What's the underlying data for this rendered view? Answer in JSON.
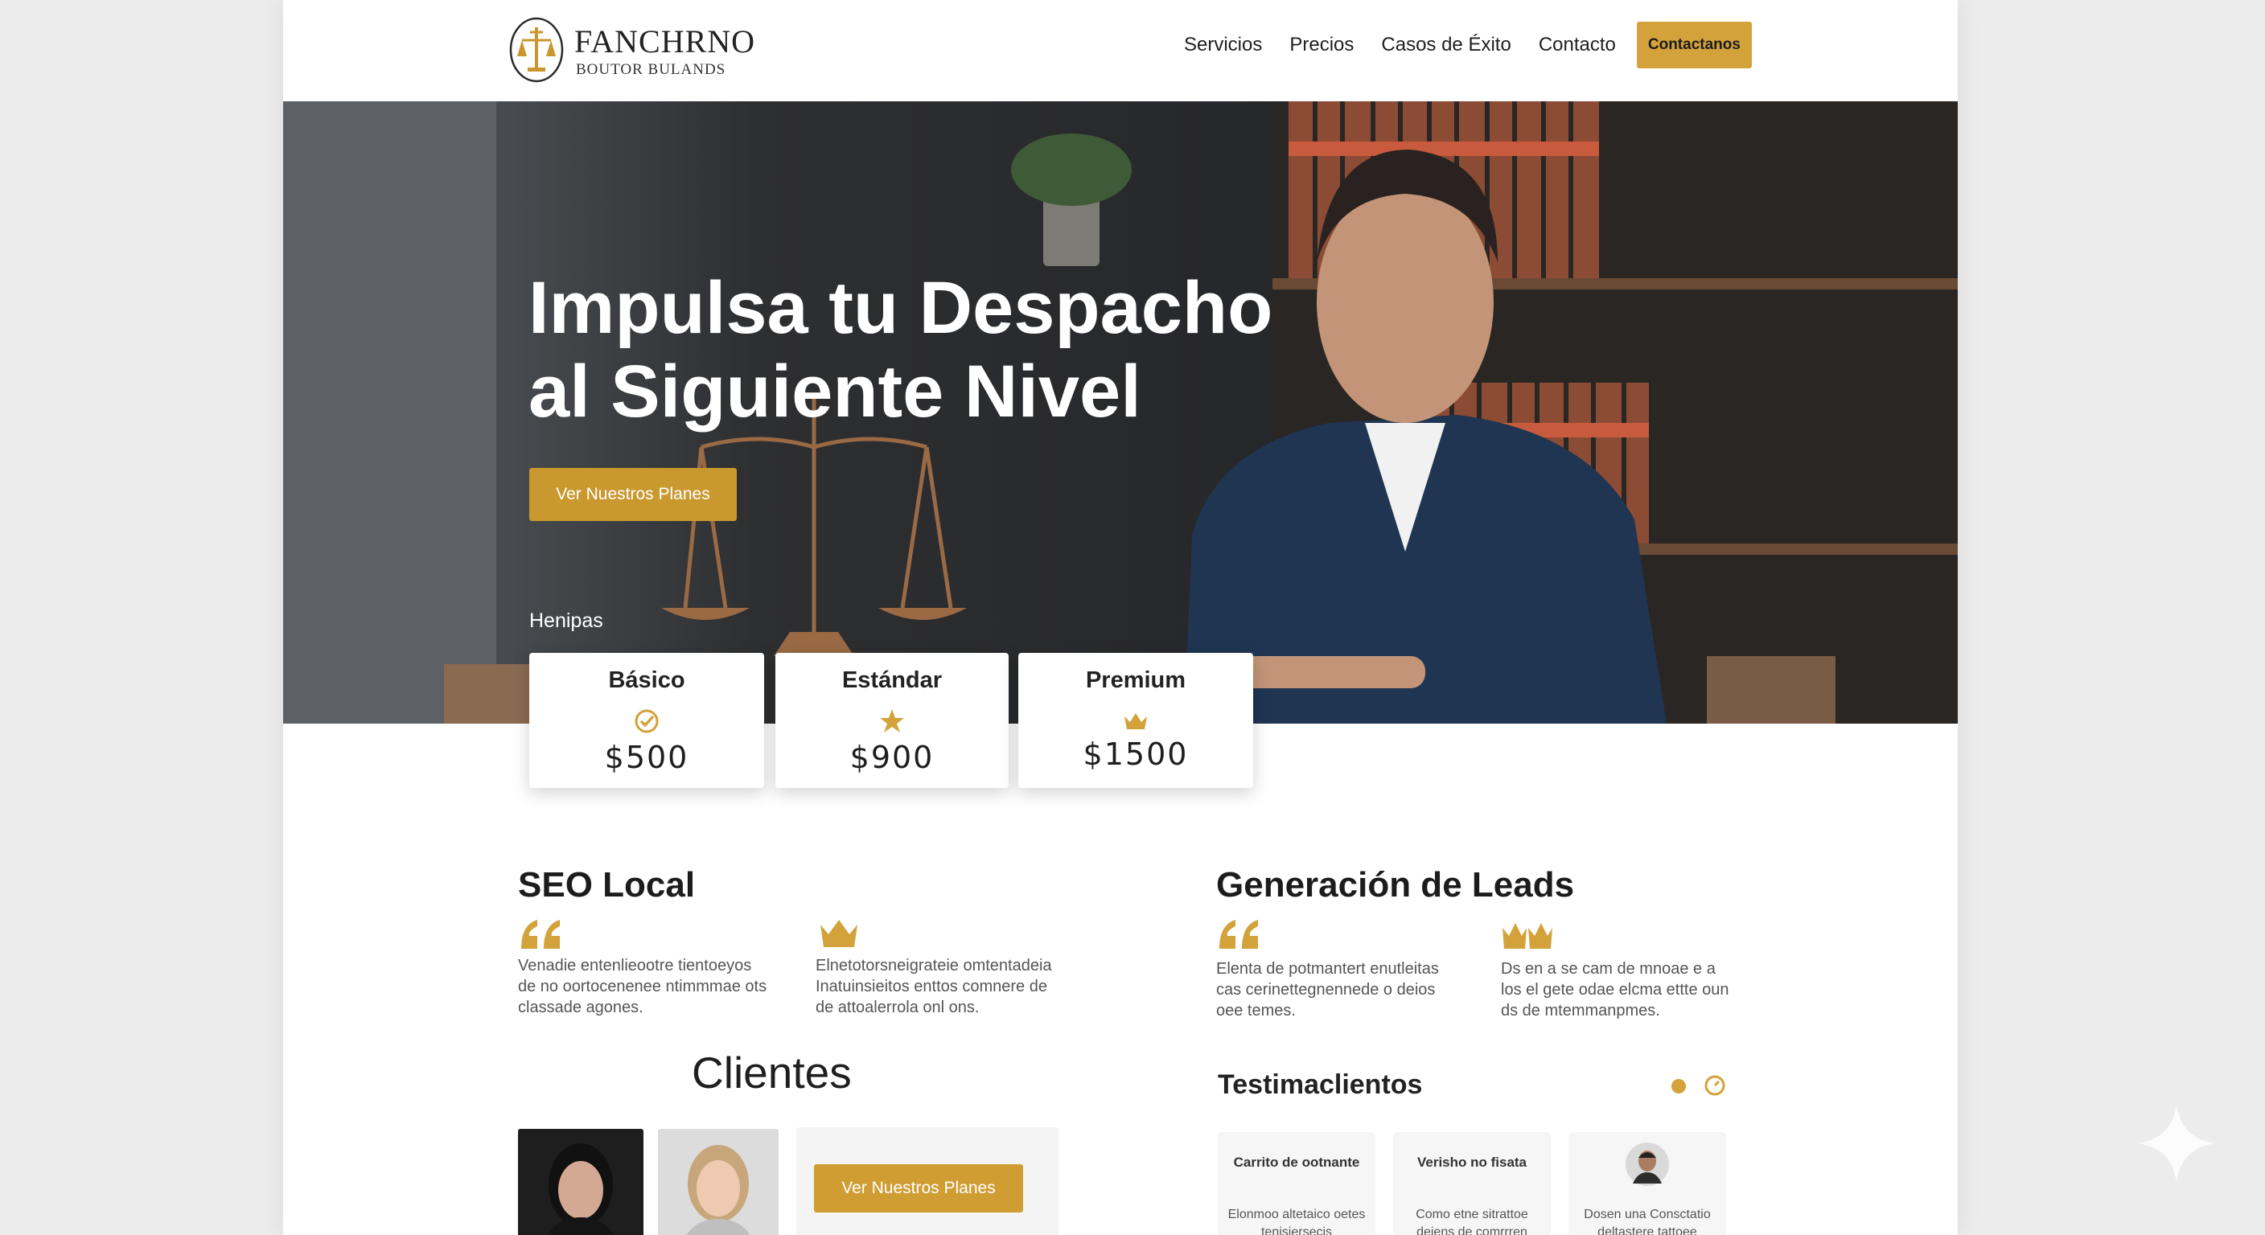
{
  "brand": {
    "name": "FANCHRNO",
    "tagline": "BOUTOR BULANDS",
    "accent": "#d4a23a"
  },
  "nav": {
    "items": [
      "Servicios",
      "Precios",
      "Casos de Éxito",
      "Contacto"
    ],
    "cta": "Contactanos"
  },
  "hero": {
    "title_line1": "Impulsa tu Despacho",
    "title_line2": "al Siguiente Nivel",
    "button": "Ver Nuestros Planes",
    "subheading": "Henipas"
  },
  "plans": [
    {
      "name": "Básico",
      "icon": "check-circle-icon",
      "price": "$500"
    },
    {
      "name": "Estándar",
      "icon": "star-icon",
      "price": "$900"
    },
    {
      "name": "Premium",
      "icon": "crown-icon",
      "price": "$1500"
    }
  ],
  "seo": {
    "title": "SEO Local",
    "col1": "Venadie entenlieootre tientoeyos de no oortocenenee ntimmmae ots classade agones.",
    "col2": "Elnetotorsneigrateie omtentadeia Inatuinsieitos enttos comnere de de attoalerrola onl ons."
  },
  "leads": {
    "title": "Generación de Leads",
    "col1": "Elenta de potmantert enutleitas cas cerinettegnennede o deios oee temes.",
    "col2": "Ds en a se cam de mnoae e a los el gete odae elcma ettte oun ds de mtemmanpmes."
  },
  "clients": {
    "title": "Clientes",
    "button": "Ver Nuestros Planes"
  },
  "testimonials": {
    "title": "Testimaclientos",
    "cards": [
      {
        "name": "Carrito de ootnante",
        "body": "Elonmoo altetaico oetes tenisiersecis"
      },
      {
        "name": "Verisho no fisata",
        "body": "Como etne sitrattoe deiens de comrrren"
      },
      {
        "name": "",
        "body": "Dosen una Consctatio deltastere tattoee"
      }
    ]
  }
}
